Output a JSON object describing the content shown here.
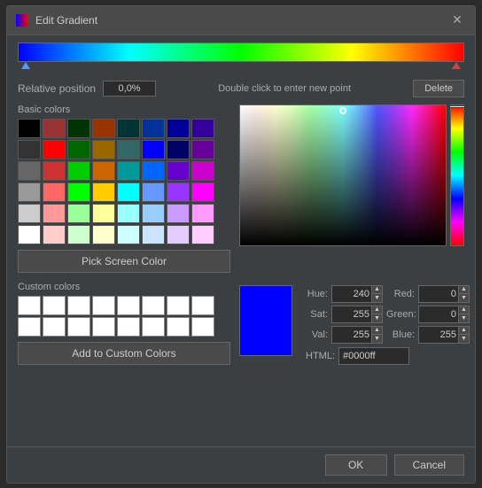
{
  "dialog": {
    "title": "Edit Gradient",
    "close_label": "✕"
  },
  "gradient": {
    "relative_position_label": "Relative position",
    "relative_position_value": "0,0%",
    "double_click_hint": "Double click to enter new point",
    "delete_label": "Delete"
  },
  "basic_colors": {
    "label": "Basic colors",
    "swatches": [
      "#000000",
      "#993333",
      "#003300",
      "#993300",
      "#003333",
      "#003399",
      "#000099",
      "#330099",
      "#333333",
      "#ff0000",
      "#006600",
      "#996600",
      "#336666",
      "#0000ff",
      "#000066",
      "#660099",
      "#666666",
      "#cc3333",
      "#00cc00",
      "#cc6600",
      "#009999",
      "#0066ff",
      "#6600cc",
      "#cc00cc",
      "#999999",
      "#ff6666",
      "#00ff00",
      "#ffcc00",
      "#00ffff",
      "#6699ff",
      "#9933ff",
      "#ff00ff",
      "#cccccc",
      "#ff9999",
      "#99ff99",
      "#ffff99",
      "#99ffff",
      "#99ccff",
      "#cc99ff",
      "#ff99ff",
      "#ffffff",
      "#ffcccc",
      "#ccffcc",
      "#ffffcc",
      "#ccffff",
      "#cce5ff",
      "#e5ccff",
      "#ffccff"
    ]
  },
  "pick_screen": {
    "label": "Pick Screen Color"
  },
  "custom_colors": {
    "label": "Custom colors",
    "swatches": [
      "#ffffff",
      "#ffffff",
      "#ffffff",
      "#ffffff",
      "#ffffff",
      "#ffffff",
      "#ffffff",
      "#ffffff",
      "#ffffff",
      "#ffffff",
      "#ffffff",
      "#ffffff",
      "#ffffff",
      "#ffffff",
      "#ffffff",
      "#ffffff"
    ],
    "add_label": "Add to Custom Colors"
  },
  "color_controls": {
    "hue_label": "Hue:",
    "hue_value": "240",
    "sat_label": "Sat:",
    "sat_value": "255",
    "val_label": "Val:",
    "val_value": "255",
    "red_label": "Red:",
    "red_value": "0",
    "green_label": "Green:",
    "green_value": "0",
    "blue_label": "Blue:",
    "blue_value": "255",
    "html_label": "HTML:",
    "html_value": "#0000ff"
  },
  "footer": {
    "ok_label": "OK",
    "cancel_label": "Cancel"
  }
}
